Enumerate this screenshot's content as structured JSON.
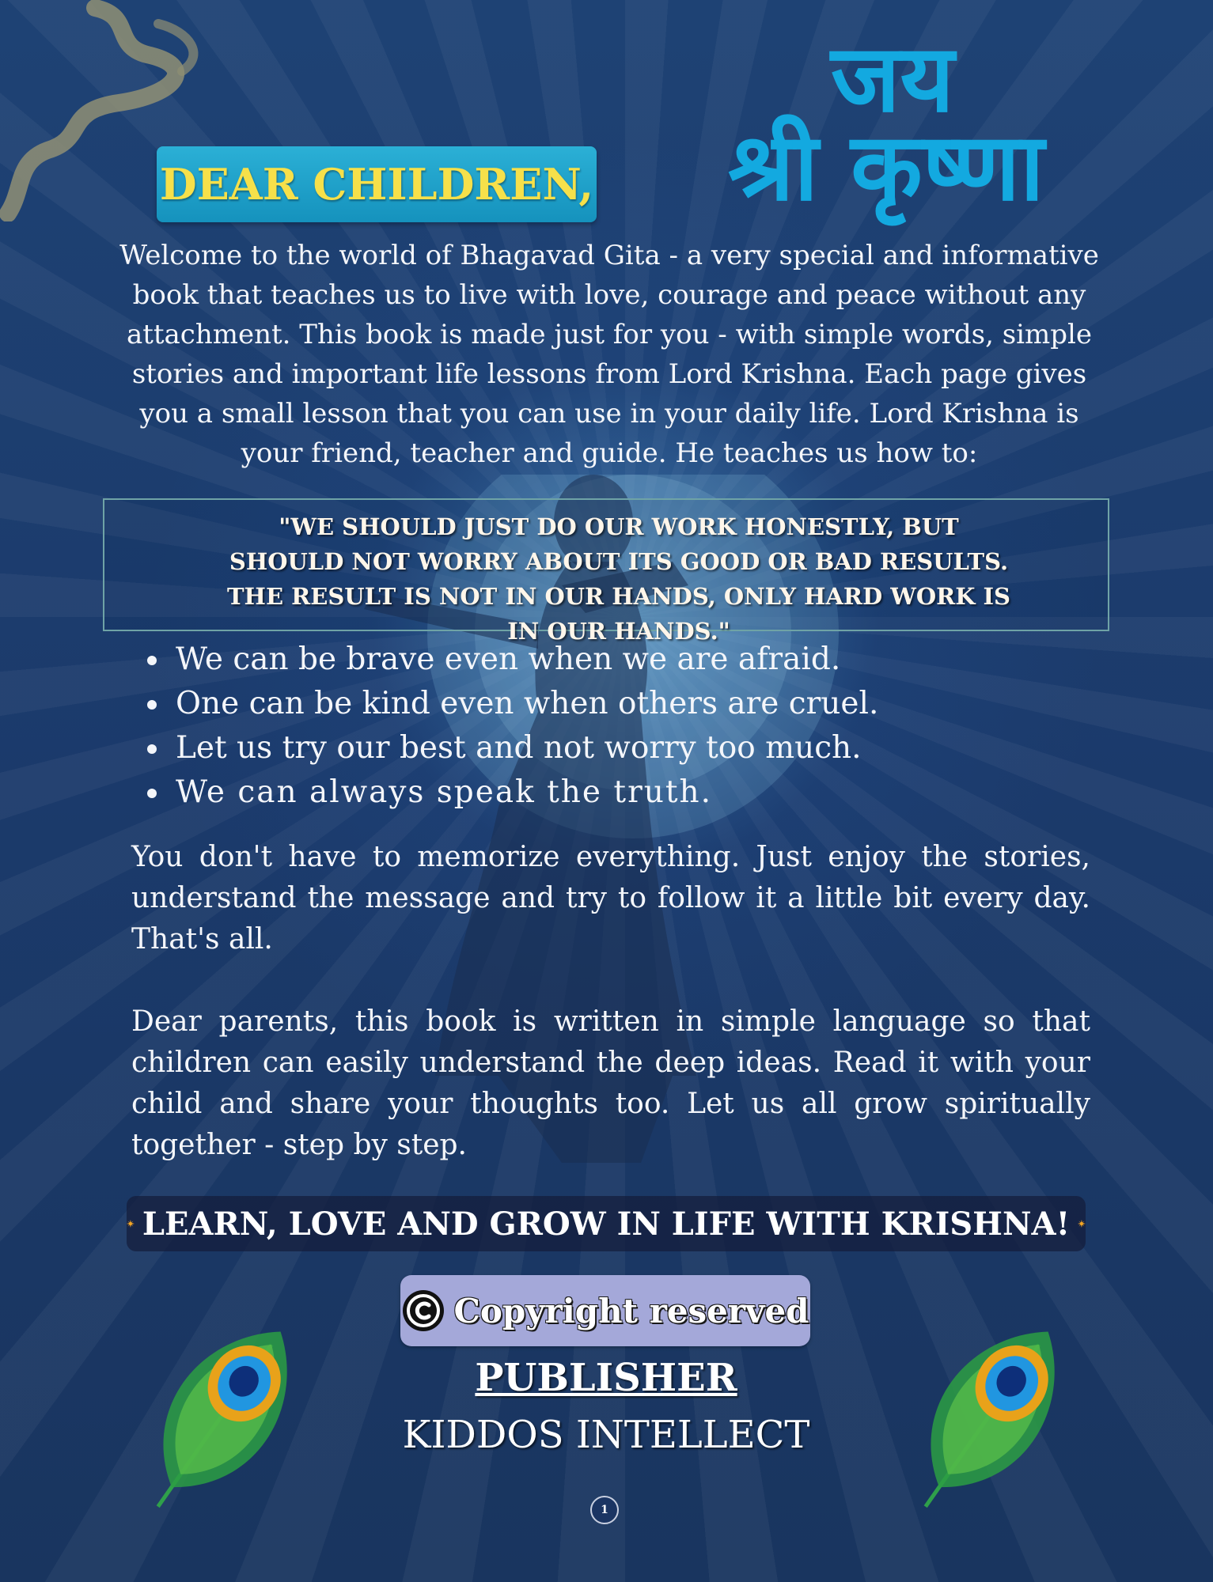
{
  "header": {
    "greeting": "DEAR CHILDREN,",
    "devanagari_line1": "जय",
    "devanagari_line2": "श्री कृष्णा"
  },
  "intro": "Welcome to the world of Bhagavad Gita - a very special and informative book that teaches us to live with love, courage and peace without any attachment. This book is made just for you - with simple words, simple stories and important life lessons from Lord Krishna. Each page gives you a small lesson that you can use in your daily life. Lord Krishna is your friend, teacher and guide. He teaches us how to:",
  "quote": "\"WE SHOULD JUST DO OUR WORK HONESTLY, BUT SHOULD NOT WORRY ABOUT ITS GOOD OR BAD RESULTS. THE RESULT IS NOT IN OUR HANDS, ONLY HARD WORK IS IN OUR HANDS.\"",
  "bullets": [
    "We can be brave even when we are afraid.",
    "One can be kind even when others are cruel.",
    "Let us try our best and not worry too much.",
    "We can always speak the truth."
  ],
  "paragraph1": "You don't have to memorize everything. Just enjoy the stories, understand the message and try to follow it a little bit every day. That's all.",
  "paragraph2": "Dear parents, this book is written in simple language so that children can easily understand the deep ideas. Read it with your child and share your thoughts too. Let us all grow spiritually together - step by step.",
  "tagline": "LEARN, LOVE AND GROW IN LIFE WITH KRISHNA!",
  "copyright": "Copyright reserved",
  "publisher_label": "PUBLISHER",
  "publisher_name": "KIDDOS INTELLECT",
  "page_number": "1",
  "colors": {
    "background": "#1d3e70",
    "badge": "#1fa3cc",
    "greeting_text": "#f6e04a",
    "devanagari": "#13a9e0",
    "copyright_badge": "#a4a8d9"
  },
  "icons": [
    "smoke-swirl-icon",
    "sun-icon",
    "copyright-icon",
    "peacock-feather-icon",
    "krishna-silhouette-icon"
  ]
}
